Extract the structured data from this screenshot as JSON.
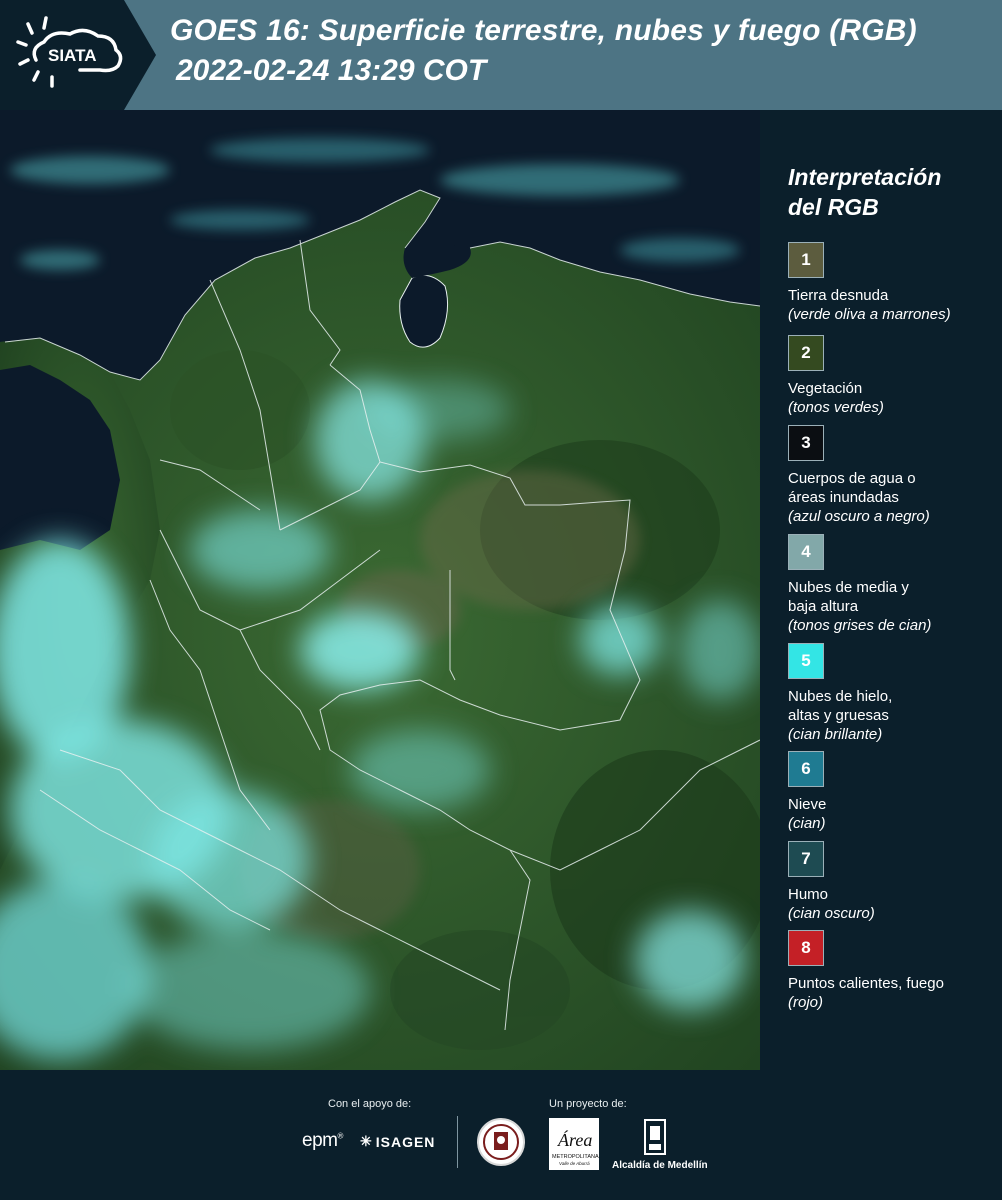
{
  "header": {
    "logo_text": "SIATA",
    "title_line1": "GOES 16: Superficie terrestre, nubes y fuego (RGB)",
    "title_line2": "2022-02-24 13:29 COT",
    "background": "#4d7484"
  },
  "legend": {
    "title_line1": "Interpretación",
    "title_line2": "del RGB",
    "items": [
      {
        "number": "1",
        "color": "#5c5c3e",
        "label": "Tierra desnuda",
        "desc": "(verde oliva a marrones)"
      },
      {
        "number": "2",
        "color": "#344a20",
        "label": "Vegetación",
        "desc": "(tonos verdes)"
      },
      {
        "number": "3",
        "color": "#0b0e12",
        "label": "Cuerpos de agua o áreas inundadas",
        "desc": "(azul oscuro a negro)"
      },
      {
        "number": "4",
        "color": "#82a8a9",
        "label": "Nubes de media y baja altura",
        "desc": "(tonos grises de cian)"
      },
      {
        "number": "5",
        "color": "#33e5e5",
        "label": "Nubes de hielo, altas y gruesas",
        "desc": "(cian brillante)"
      },
      {
        "number": "6",
        "color": "#1f7b92",
        "label": "Nieve",
        "desc": "(cian)"
      },
      {
        "number": "7",
        "color": "#1e4b52",
        "label": "Humo",
        "desc": "(cian oscuro)"
      },
      {
        "number": "8",
        "color": "#c42026",
        "label": "Puntos calientes, fuego",
        "desc": "(rojo)"
      }
    ]
  },
  "footer": {
    "support_label": "Con el apoyo de:",
    "project_label": "Un proyecto de:",
    "epm": "epm",
    "isagen": "ISAGEN",
    "area_text": "Área",
    "area_sub": "METROPOLITANA",
    "area_sub2": "Valle de Aburrá",
    "alcaldia": "Alcaldía de Medellín"
  },
  "colors": {
    "ocean": "#0c1a2a",
    "vegetation": "#2e5a2a",
    "cloud": "#7fe8e6",
    "border": "#e8f0f0"
  }
}
